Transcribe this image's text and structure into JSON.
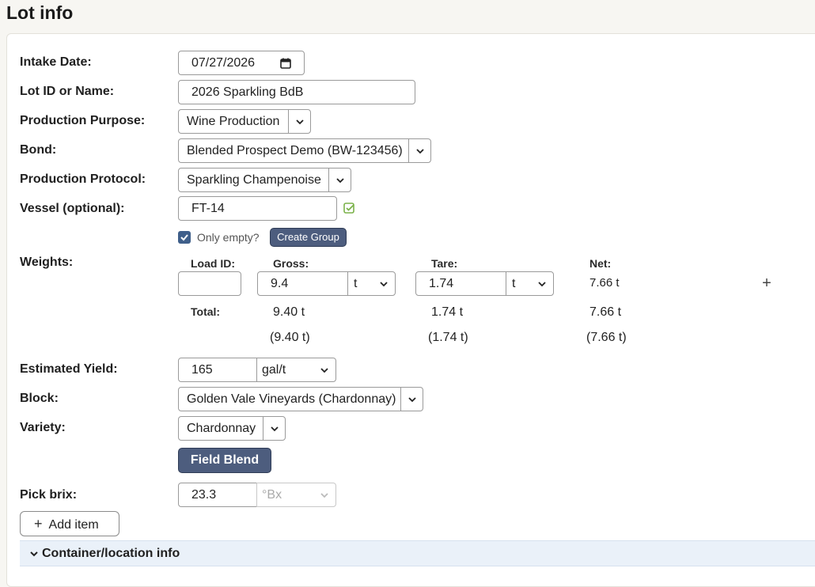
{
  "page": {
    "title": "Lot info"
  },
  "form": {
    "intake_date": {
      "label": "Intake Date:",
      "value": "07/27/2026"
    },
    "lot_id": {
      "label": "Lot ID or Name:",
      "value": "2026 Sparkling BdB"
    },
    "production_purpose": {
      "label": "Production Purpose:",
      "value": "Wine Production"
    },
    "bond": {
      "label": "Bond:",
      "value": "Blended Prospect Demo (BW-123456)"
    },
    "production_protocol": {
      "label": "Production Protocol:",
      "value": "Sparkling Champenoise"
    },
    "vessel": {
      "label": "Vessel (optional):",
      "value": "FT-14",
      "only_empty_label": "Only empty?",
      "only_empty_checked": true,
      "create_group_label": "Create Group"
    },
    "weights": {
      "label": "Weights:",
      "headers": {
        "load_id": "Load ID:",
        "gross": "Gross:",
        "tare": "Tare:",
        "net": "Net:"
      },
      "row": {
        "load_id": "",
        "gross": "9.4",
        "gross_unit": "t",
        "tare": "1.74",
        "tare_unit": "t",
        "net": "7.66 t"
      },
      "total_label": "Total:",
      "totals": {
        "gross": "9.40 t",
        "tare": "1.74 t",
        "net": "7.66 t"
      },
      "totals_alt": {
        "gross": "(9.40 t)",
        "tare": "(1.74 t)",
        "net": "(7.66 t)"
      }
    },
    "estimated_yield": {
      "label": "Estimated Yield:",
      "value": "165",
      "unit": "gal/t"
    },
    "block": {
      "label": "Block:",
      "value": "Golden Vale Vineyards (Chardonnay)"
    },
    "variety": {
      "label": "Variety:",
      "value": "Chardonnay",
      "field_blend_label": "Field Blend"
    },
    "pick_brix": {
      "label": "Pick brix:",
      "value": "23.3",
      "unit": "°Bx"
    },
    "add_item_label": "Add item",
    "container_section_label": "Container/location info"
  },
  "colors": {
    "accent": "#4d5d7e",
    "check_green": "#7bb24a",
    "section_bg": "#eaf1f9"
  }
}
